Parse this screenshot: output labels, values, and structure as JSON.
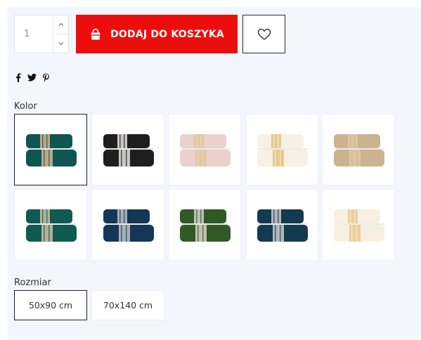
{
  "quantity": {
    "value": "1"
  },
  "actions": {
    "add_to_cart_label": "DODAJ DO KOSZYKA",
    "accent_color": "#ee0d0d"
  },
  "share": {
    "icons": [
      "facebook-icon",
      "twitter-icon",
      "pinterest-icon"
    ]
  },
  "color": {
    "label": "Kolor",
    "selected_index": 0,
    "swatches": [
      {
        "base": "#0f5551",
        "band": "#b9a98a",
        "icon": "towel-icon"
      },
      {
        "base": "#1e1e1e",
        "band": "#c8c6c2",
        "icon": "towel-icon"
      },
      {
        "base": "#ead1cd",
        "band": "#e2c9a3",
        "icon": "towel-icon"
      },
      {
        "base": "#f6f1e3",
        "band": "#e7c98c",
        "icon": "towel-icon"
      },
      {
        "base": "#cbb390",
        "band": "#dcc6a0",
        "icon": "towel-icon"
      },
      {
        "base": "#0f5a52",
        "band": "#b5b09b",
        "icon": "towel-icon"
      },
      {
        "base": "#163658",
        "band": "#a9b0b6",
        "icon": "towel-icon"
      },
      {
        "base": "#2f5a26",
        "band": "#c2c0b4",
        "icon": "towel-icon"
      },
      {
        "base": "#143a4f",
        "band": "#b0b7ba",
        "icon": "towel-icon"
      },
      {
        "base": "#f7f0e0",
        "band": "#e9cf9a",
        "icon": "towel-icon"
      }
    ]
  },
  "size": {
    "label": "Rozmiar",
    "selected_index": 0,
    "options": [
      "50x90 cm",
      "70x140 cm"
    ]
  }
}
